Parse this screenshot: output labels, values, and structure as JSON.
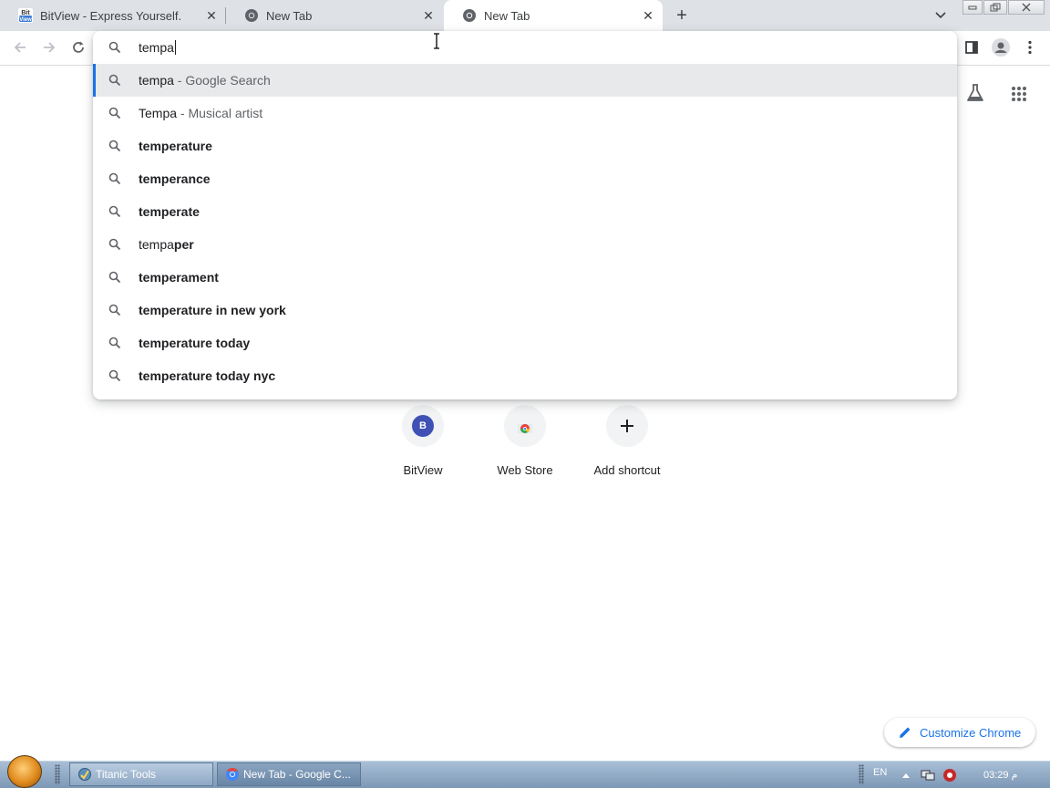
{
  "tabs": [
    {
      "title": "BitView - Express Yourself.",
      "favicon": "bitview-icon",
      "active": false
    },
    {
      "title": "New Tab",
      "favicon": "chrome-icon",
      "active": false
    },
    {
      "title": "New Tab",
      "favicon": "chrome-icon",
      "active": true
    }
  ],
  "omnibox": {
    "query": "tempa",
    "suggestions": [
      {
        "bold": "",
        "plain": "tempa",
        "suffix": " - Google Search"
      },
      {
        "bold": "",
        "plain": "Tempa",
        "suffix": " - Musical artist"
      },
      {
        "bold": "temperature",
        "plain": "",
        "suffix": ""
      },
      {
        "bold": "temperance",
        "plain": "",
        "suffix": ""
      },
      {
        "bold": "temperate",
        "plain": "",
        "suffix": ""
      },
      {
        "prefix": "tempa",
        "bold": "per",
        "plain": "",
        "suffix": ""
      },
      {
        "bold": "temperament",
        "plain": "",
        "suffix": ""
      },
      {
        "bold": "temperature in new york",
        "plain": "",
        "suffix": ""
      },
      {
        "bold": "temperature today",
        "plain": "",
        "suffix": ""
      },
      {
        "bold": "temperature today nyc",
        "plain": "",
        "suffix": ""
      }
    ]
  },
  "shortcuts": [
    {
      "label": "BitView",
      "letter": "B"
    },
    {
      "label": "Web Store"
    },
    {
      "label": "Add shortcut"
    }
  ],
  "customize_label": "Customize Chrome",
  "taskbar": {
    "buttons": [
      {
        "label": "Titanic Tools"
      },
      {
        "label": "New Tab - Google C..."
      }
    ],
    "lang": "EN",
    "clock": "03:29 م"
  },
  "colors": {
    "accent": "#1a73e8",
    "tabstrip": "#dee1e6",
    "taskbar": "#8ea8c4"
  }
}
